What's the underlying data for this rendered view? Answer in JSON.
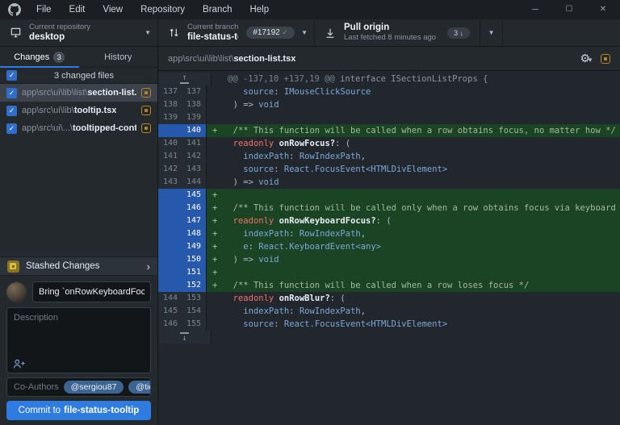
{
  "colors": {
    "accent_blue": "#2e7ce0",
    "added_line_green": "#1b4424",
    "line_selection_blue": "#2659ab",
    "modified_status_yellow": "#b8861f",
    "pr_check_green": "#57ab5a"
  },
  "titlebar": {
    "menu": [
      "File",
      "Edit",
      "View",
      "Repository",
      "Branch",
      "Help"
    ],
    "window_controls": [
      {
        "name": "minimize",
        "glyph": "─"
      },
      {
        "name": "maximize",
        "glyph": "☐"
      },
      {
        "name": "close",
        "glyph": "✕"
      }
    ]
  },
  "toolbar": {
    "repository": {
      "label": "Current repository",
      "value": "desktop"
    },
    "branch": {
      "label": "Current branch",
      "value": "file-status-too...",
      "pr_badge": "#17192",
      "pr_check": "✓"
    },
    "pull": {
      "title": "Pull origin",
      "subtitle": "Last fetched 8 minutes ago",
      "count": "3 ↓"
    }
  },
  "sidebar": {
    "tabs": [
      {
        "label": "Changes",
        "badge": "3"
      },
      {
        "label": "History"
      }
    ],
    "files_header": "3 changed files",
    "files": [
      {
        "path": "app\\src\\ui\\lib\\list\\",
        "name": "section-list.tsx",
        "selected": true,
        "status": "modified"
      },
      {
        "path": "app\\src\\ui\\lib\\",
        "name": "tooltip.tsx",
        "selected": false,
        "status": "modified"
      },
      {
        "path": "app\\src\\ui\\...\\",
        "name": "tooltipped-content.tsx",
        "selected": false,
        "status": "modified"
      }
    ],
    "stash": {
      "label": "Stashed Changes"
    },
    "commit": {
      "summary_value": "Bring `onRowKeyboardFocus` to `Se",
      "description_placeholder": "Description",
      "coauthors_label": "Co-Authors",
      "coauthors": [
        "@sergiou87",
        "@tidy-dev"
      ],
      "button_prefix": "Commit to",
      "button_branch": "file-status-tooltip"
    }
  },
  "diff": {
    "file_path": "app\\src\\ui\\lib\\list\\",
    "file_name": "section-list.tsx",
    "lines": [
      {
        "type": "hunk",
        "seg": [
          {
            "t": "@@ -137,10 +137,19 @@",
            "c": "hr"
          },
          {
            "t": " interface ISectionListProps {",
            "c": "hc"
          }
        ]
      },
      {
        "type": "context",
        "old": "137",
        "new": "137",
        "seg": [
          {
            "t": "    ",
            "c": "pln"
          },
          {
            "t": "source",
            "c": "blue"
          },
          {
            "t": ": ",
            "c": "pln"
          },
          {
            "t": "IMouseClickSource",
            "c": "blue"
          }
        ]
      },
      {
        "type": "context",
        "old": "138",
        "new": "138",
        "seg": [
          {
            "t": "  ) => ",
            "c": "pln"
          },
          {
            "t": "void",
            "c": "blue"
          }
        ]
      },
      {
        "type": "context",
        "old": "139",
        "new": "139",
        "seg": []
      },
      {
        "type": "added",
        "old": "",
        "new": "140",
        "seg": [
          {
            "t": "  ",
            "c": "pln"
          },
          {
            "t": "/** This function will be called when a row obtains focus, no matter how */",
            "c": "cm"
          }
        ]
      },
      {
        "type": "context",
        "old": "140",
        "new": "141",
        "seg": [
          {
            "t": "  ",
            "c": "pln"
          },
          {
            "t": "readonly ",
            "c": "kw"
          },
          {
            "t": "onRowFocus?",
            "c": "fn"
          },
          {
            "t": ": (",
            "c": "pln"
          }
        ]
      },
      {
        "type": "context",
        "old": "141",
        "new": "142",
        "seg": [
          {
            "t": "    ",
            "c": "pln"
          },
          {
            "t": "indexPath",
            "c": "blue"
          },
          {
            "t": ": ",
            "c": "pln"
          },
          {
            "t": "RowIndexPath",
            "c": "blue"
          },
          {
            "t": ",",
            "c": "pln"
          }
        ]
      },
      {
        "type": "context",
        "old": "142",
        "new": "143",
        "seg": [
          {
            "t": "    ",
            "c": "pln"
          },
          {
            "t": "source",
            "c": "blue"
          },
          {
            "t": ": ",
            "c": "pln"
          },
          {
            "t": "React.FocusEvent<HTMLDivElement>",
            "c": "blue"
          }
        ]
      },
      {
        "type": "context",
        "old": "143",
        "new": "144",
        "seg": [
          {
            "t": "  ) => ",
            "c": "pln"
          },
          {
            "t": "void",
            "c": "blue"
          }
        ]
      },
      {
        "type": "added",
        "old": "",
        "new": "145",
        "seg": []
      },
      {
        "type": "added",
        "old": "",
        "new": "146",
        "seg": [
          {
            "t": "  ",
            "c": "pln"
          },
          {
            "t": "/** This function will be called only when a row obtains focus via keyboard */",
            "c": "cm"
          }
        ]
      },
      {
        "type": "added",
        "old": "",
        "new": "147",
        "seg": [
          {
            "t": "  ",
            "c": "pln"
          },
          {
            "t": "readonly ",
            "c": "kw"
          },
          {
            "t": "onRowKeyboardFocus?",
            "c": "fn"
          },
          {
            "t": ": (",
            "c": "pln"
          }
        ]
      },
      {
        "type": "added",
        "old": "",
        "new": "148",
        "seg": [
          {
            "t": "    ",
            "c": "pln"
          },
          {
            "t": "indexPath",
            "c": "blue"
          },
          {
            "t": ": ",
            "c": "pln"
          },
          {
            "t": "RowIndexPath",
            "c": "blue"
          },
          {
            "t": ",",
            "c": "pln"
          }
        ]
      },
      {
        "type": "added",
        "old": "",
        "new": "149",
        "seg": [
          {
            "t": "    ",
            "c": "pln"
          },
          {
            "t": "e",
            "c": "blue"
          },
          {
            "t": ": ",
            "c": "pln"
          },
          {
            "t": "React.KeyboardEvent<any>",
            "c": "blue"
          }
        ]
      },
      {
        "type": "added",
        "old": "",
        "new": "150",
        "seg": [
          {
            "t": "  ) => ",
            "c": "pln"
          },
          {
            "t": "void",
            "c": "blue"
          }
        ]
      },
      {
        "type": "added",
        "old": "",
        "new": "151",
        "seg": []
      },
      {
        "type": "added",
        "old": "",
        "new": "152",
        "seg": [
          {
            "t": "  ",
            "c": "pln"
          },
          {
            "t": "/** This function will be called when a row loses focus */",
            "c": "cm"
          }
        ]
      },
      {
        "type": "context",
        "old": "144",
        "new": "153",
        "seg": [
          {
            "t": "  ",
            "c": "pln"
          },
          {
            "t": "readonly ",
            "c": "kw"
          },
          {
            "t": "onRowBlur?",
            "c": "fn"
          },
          {
            "t": ": (",
            "c": "pln"
          }
        ]
      },
      {
        "type": "context",
        "old": "145",
        "new": "154",
        "seg": [
          {
            "t": "    ",
            "c": "pln"
          },
          {
            "t": "indexPath",
            "c": "blue"
          },
          {
            "t": ": ",
            "c": "pln"
          },
          {
            "t": "RowIndexPath",
            "c": "blue"
          },
          {
            "t": ",",
            "c": "pln"
          }
        ]
      },
      {
        "type": "context",
        "old": "146",
        "new": "155",
        "seg": [
          {
            "t": "    ",
            "c": "pln"
          },
          {
            "t": "source",
            "c": "blue"
          },
          {
            "t": ": ",
            "c": "pln"
          },
          {
            "t": "React.FocusEvent<HTMLDivElement>",
            "c": "blue"
          }
        ]
      },
      {
        "type": "expand-down"
      }
    ]
  }
}
